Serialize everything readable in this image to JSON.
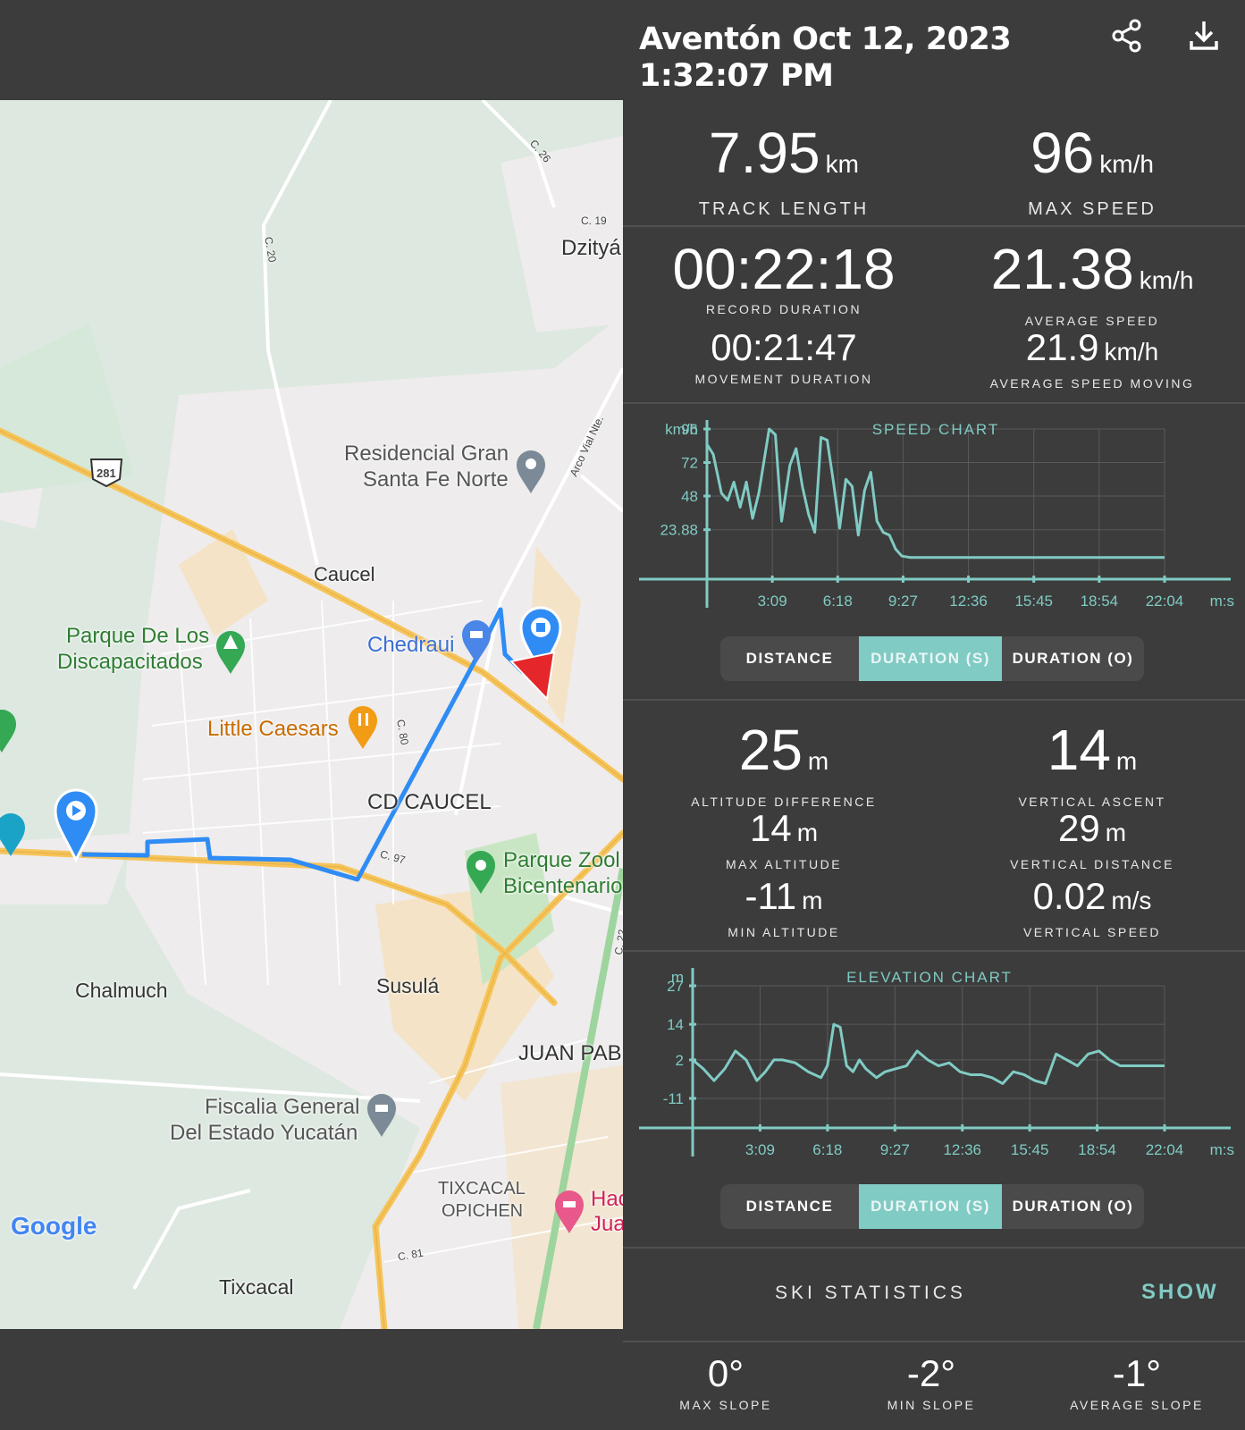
{
  "header": {
    "title_line1": "Aventón Oct 12, 2023",
    "title_line2": "1:32:07 PM",
    "share_icon": "share-icon",
    "download_icon": "download-icon"
  },
  "stats": {
    "track_length": {
      "value": "7.95",
      "unit": "km",
      "label": "TRACK LENGTH"
    },
    "max_speed": {
      "value": "96",
      "unit": "km/h",
      "label": "MAX SPEED"
    },
    "record_duration": {
      "value": "00:22:18",
      "label": "RECORD DURATION"
    },
    "average_speed": {
      "value": "21.38",
      "unit": "km/h",
      "label": "AVERAGE SPEED"
    },
    "movement_duration": {
      "value": "00:21:47",
      "label": "MOVEMENT DURATION"
    },
    "average_speed_moving": {
      "value": "21.9",
      "unit": "km/h",
      "label": "AVERAGE SPEED MOVING"
    },
    "altitude_difference": {
      "value": "25",
      "unit": "m",
      "label": "ALTITUDE DIFFERENCE"
    },
    "vertical_ascent": {
      "value": "14",
      "unit": "m",
      "label": "VERTICAL ASCENT"
    },
    "max_altitude": {
      "value": "14",
      "unit": "m",
      "label": "MAX ALTITUDE"
    },
    "vertical_distance": {
      "value": "29",
      "unit": "m",
      "label": "VERTICAL DISTANCE"
    },
    "min_altitude": {
      "value": "-11",
      "unit": "m",
      "label": "MIN ALTITUDE"
    },
    "vertical_speed": {
      "value": "0.02",
      "unit": "m/s",
      "label": "VERTICAL SPEED"
    }
  },
  "speed_chart": {
    "title": "SPEED CHART",
    "y_unit": "km/h",
    "x_unit": "m:s",
    "y_ticks": [
      "96",
      "72",
      "48",
      "23.88"
    ],
    "x_ticks": [
      "3:09",
      "6:18",
      "9:27",
      "12:36",
      "15:45",
      "18:54",
      "22:04"
    ]
  },
  "elevation_chart": {
    "title": "ELEVATION CHART",
    "y_unit": "m",
    "x_unit": "m:s",
    "y_ticks": [
      "27",
      "14",
      "2",
      "-11"
    ],
    "x_ticks": [
      "3:09",
      "6:18",
      "9:27",
      "12:36",
      "15:45",
      "18:54",
      "22:04"
    ]
  },
  "chart_data": [
    {
      "type": "line",
      "title": "SPEED CHART",
      "ylabel": "km/h",
      "xlabel": "m:s",
      "ylim": [
        0,
        96
      ],
      "xlim": [
        0,
        22.07
      ],
      "series": [
        {
          "x": [
            0,
            0.3,
            0.7,
            1.0,
            1.3,
            1.6,
            1.9,
            2.2,
            2.5,
            3.0,
            3.3,
            3.6,
            4.0,
            4.3,
            4.6,
            4.9,
            5.2,
            5.5,
            5.8,
            6.1,
            6.4,
            6.7,
            7.0,
            7.3,
            7.6,
            7.9,
            8.2,
            8.5,
            8.8,
            9.1,
            9.4,
            9.8,
            10.3,
            11,
            13,
            16,
            19,
            22.07
          ],
          "y": [
            85,
            78,
            50,
            45,
            58,
            40,
            58,
            32,
            50,
            96,
            92,
            30,
            70,
            82,
            55,
            35,
            22,
            90,
            88,
            58,
            25,
            60,
            55,
            20,
            52,
            65,
            30,
            22,
            20,
            10,
            5,
            4,
            4,
            4,
            4,
            4,
            4,
            4
          ]
        }
      ],
      "x_ticks": [
        "3:09",
        "6:18",
        "9:27",
        "12:36",
        "15:45",
        "18:54",
        "22:04"
      ]
    },
    {
      "type": "line",
      "title": "ELEVATION CHART",
      "ylabel": "m",
      "xlabel": "m:s",
      "ylim": [
        -11,
        27
      ],
      "xlim": [
        0,
        22.07
      ],
      "series": [
        {
          "x": [
            0,
            0.5,
            1.0,
            1.5,
            2.0,
            2.5,
            3.0,
            3.4,
            3.8,
            4.2,
            4.8,
            5.4,
            6.0,
            6.3,
            6.6,
            6.9,
            7.2,
            7.5,
            7.8,
            8.1,
            8.6,
            9.0,
            9.5,
            10.0,
            10.5,
            11.0,
            11.5,
            12.0,
            12.5,
            13.0,
            13.5,
            14.0,
            14.5,
            15.0,
            15.5,
            16.0,
            16.5,
            17.0,
            17.5,
            18.0,
            18.5,
            19.0,
            19.5,
            20.0,
            20.5,
            21.0,
            21.5,
            22.07
          ],
          "y": [
            2,
            -1,
            -5,
            -1,
            5,
            2,
            -5,
            -2,
            2,
            2,
            1,
            -2,
            -4,
            0,
            14,
            13,
            0,
            -2,
            2,
            -1,
            -4,
            -2,
            -1,
            0,
            5,
            2,
            0,
            1,
            -2,
            -3,
            -3,
            -4,
            -6,
            -2,
            -3,
            -5,
            -6,
            4,
            2,
            0,
            4,
            5,
            2,
            0,
            0,
            0,
            0,
            0
          ]
        }
      ],
      "x_ticks": [
        "3:09",
        "6:18",
        "9:27",
        "12:36",
        "15:45",
        "18:54",
        "22:04"
      ]
    }
  ],
  "chart_toggles": {
    "speed": {
      "options": [
        "DISTANCE",
        "DURATION (S)",
        "DURATION (O)"
      ],
      "selected": "DURATION (S)"
    },
    "elevation": {
      "options": [
        "DISTANCE",
        "DURATION (S)",
        "DURATION (O)"
      ],
      "selected": "DURATION (S)"
    }
  },
  "ski": {
    "label": "SKI STATISTICS",
    "action": "SHOW"
  },
  "slopes": {
    "max_slope": {
      "value": "0",
      "unit": "°",
      "label": "MAX SLOPE"
    },
    "min_slope": {
      "value": "-2",
      "unit": "°",
      "label": "MIN SLOPE"
    },
    "average_slope": {
      "value": "-1",
      "unit": "°",
      "label": "AVERAGE SLOPE"
    }
  },
  "map": {
    "places": [
      "Residencial Gran",
      "Santa Fe Norte",
      "Caucel",
      "Parque De Los",
      "Discapacitados",
      "Chedraui",
      "Little Caesars",
      "CD CAUCEL",
      "Parque Zool",
      "Bicentenario",
      "Chalmuch",
      "Susulá",
      "JUAN PAB",
      "Fiscalia General",
      "Del Estado Yucatán",
      "TIXCACAL",
      "OPICHEN",
      "Hac",
      "Jua",
      "Tixcacal",
      "Dzityá"
    ],
    "roads": [
      "C. 26",
      "C. 19",
      "C. 20",
      "281",
      "Arco Vial Nte.",
      "C. 80",
      "C. 97",
      "C. 22",
      "C. 81"
    ],
    "brand": "Google",
    "colors": {
      "route": "#2f8cf5",
      "highway": "#f6c45a",
      "park": "#c9e6c4",
      "urban": "#eeecec"
    }
  }
}
